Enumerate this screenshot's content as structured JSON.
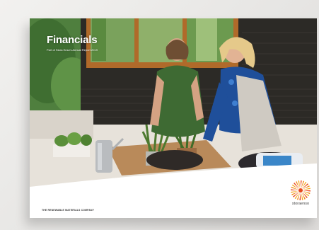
{
  "cover": {
    "title": "Financials",
    "subtitle": "Part of Stora Enso's Annual Report 2019",
    "tagline": "THE RENEWABLE MATERIALS COMPANY",
    "photo_icon": "cover-photograph",
    "logo": {
      "icon": "sunburst-logo-icon",
      "wordmark": "storaenso",
      "colors": [
        "#e8481e",
        "#f28c1c",
        "#f6a821"
      ]
    }
  }
}
